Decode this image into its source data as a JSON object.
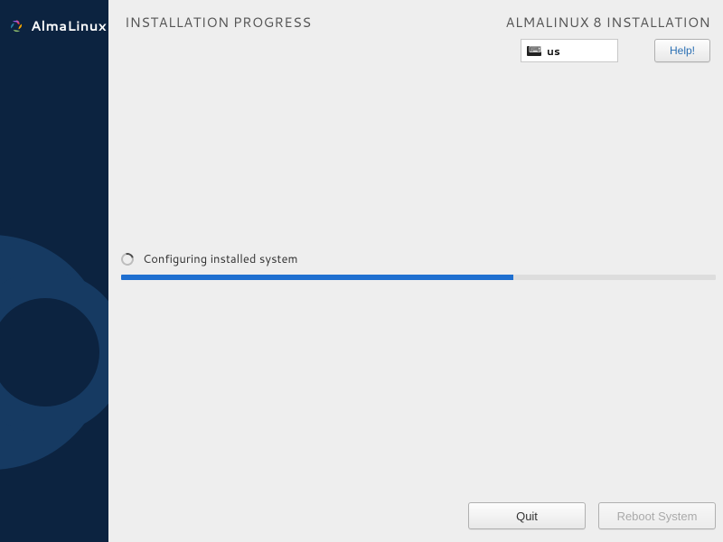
{
  "brand": {
    "name": "AlmaLinux"
  },
  "header": {
    "page_title": "INSTALLATION PROGRESS",
    "install_title": "ALMALINUX 8 INSTALLATION",
    "keyboard_layout": "us",
    "help_label": "Help!"
  },
  "progress": {
    "status_text": "Configuring installed system",
    "percent": 66
  },
  "footer": {
    "quit_label": "Quit",
    "reboot_label": "Reboot System",
    "reboot_enabled": false
  }
}
